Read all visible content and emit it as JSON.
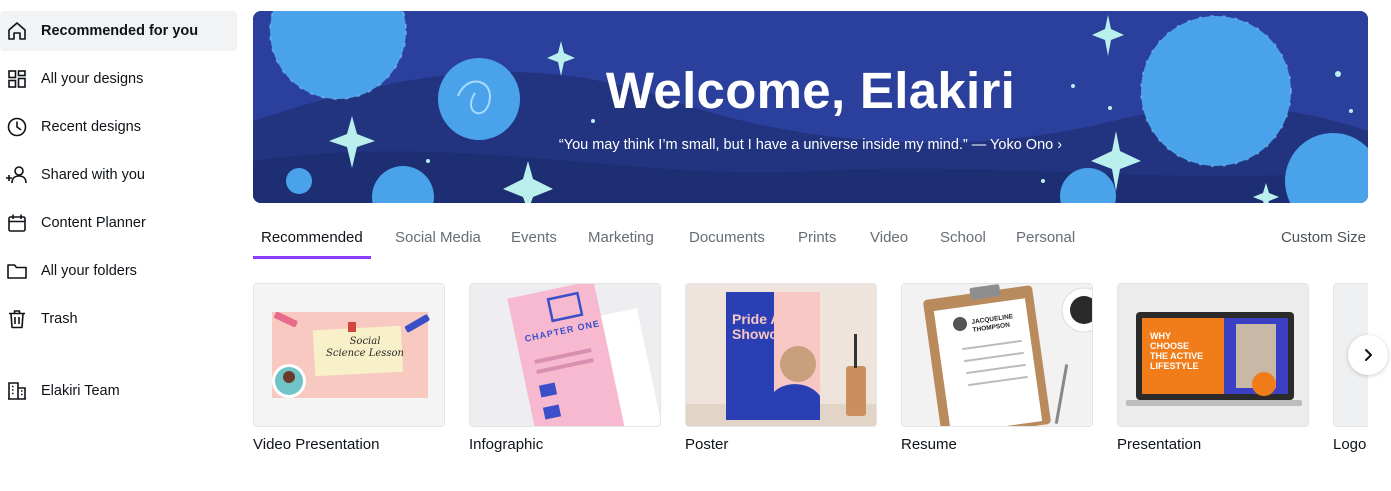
{
  "sidebar": {
    "items": [
      {
        "label": "Recommended for you",
        "icon": "home-icon"
      },
      {
        "label": "All your designs",
        "icon": "grid-icon"
      },
      {
        "label": "Recent designs",
        "icon": "clock-icon"
      },
      {
        "label": "Shared with you",
        "icon": "shared-users-icon"
      },
      {
        "label": "Content Planner",
        "icon": "calendar-icon"
      },
      {
        "label": "All your folders",
        "icon": "folder-icon"
      },
      {
        "label": "Trash",
        "icon": "trash-icon"
      },
      {
        "label": "Elakiri Team",
        "icon": "building-icon"
      }
    ],
    "active_index": 0
  },
  "banner": {
    "title": "Welcome, Elakiri",
    "quote": "“You may think I’m small, but I have a universe inside my mind.” — Yoko Ono ›"
  },
  "tabs": {
    "items": [
      "Recommended",
      "Social Media",
      "Events",
      "Marketing",
      "Documents",
      "Prints",
      "Video",
      "School",
      "Personal"
    ],
    "active_index": 0,
    "custom_size": "Custom Size"
  },
  "cards": [
    {
      "label": "Video Presentation",
      "thumb_text": [
        "Social",
        "Science Lesson"
      ]
    },
    {
      "label": "Infographic",
      "thumb_text": [
        "CHAPTER ONE"
      ]
    },
    {
      "label": "Poster",
      "thumb_text": [
        "Pride Art",
        "Showcase"
      ]
    },
    {
      "label": "Resume",
      "thumb_text": [
        "JACQUELINE",
        "THOMPSON"
      ]
    },
    {
      "label": "Presentation",
      "thumb_text": [
        "WHY",
        "CHOOSE",
        "THE ACTIVE",
        "LIFESTYLE"
      ]
    },
    {
      "label": "Logo"
    }
  ],
  "colors": {
    "accent": "#8b3dff",
    "banner_bg": "#2b3f9c",
    "banner_light": "#4aa3ea"
  }
}
